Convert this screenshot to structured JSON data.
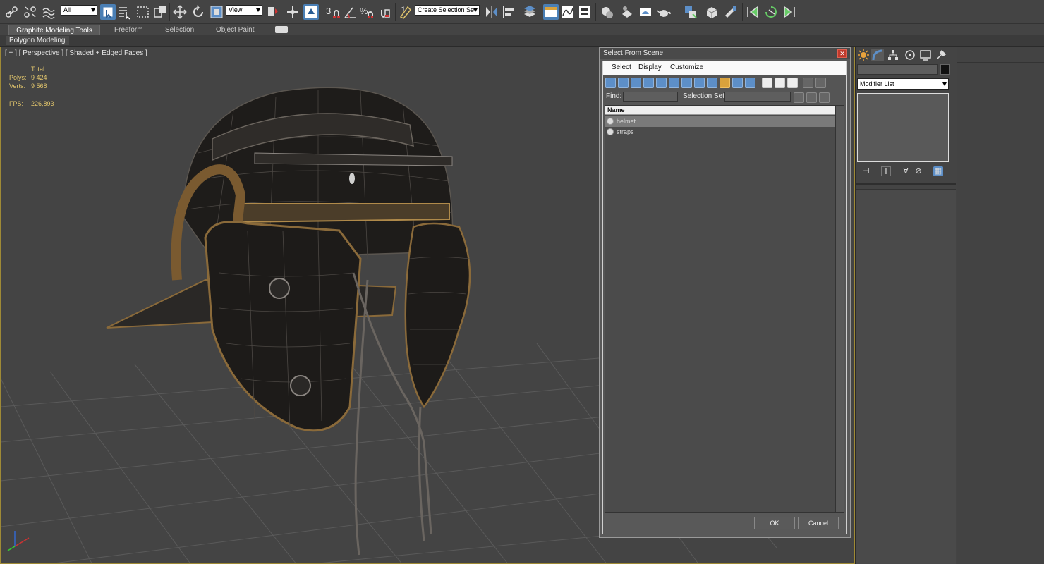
{
  "toolbar": {
    "selection_filter": "All",
    "reference_coord": "View",
    "snap_labels": [
      "3",
      "%",
      "n"
    ],
    "named_selection_placeholder": "Create Selection Se",
    "icons": [
      "link-icon",
      "unlink-icon",
      "bind-spacewarp-icon",
      "select-object-icon",
      "select-by-name-icon",
      "rect-region-icon",
      "window-crossing-icon",
      "move-icon",
      "rotate-icon",
      "scale-icon",
      "select-manipulate-icon",
      "keyboard-shortcut-icon",
      "snaps-toggle-icon",
      "angle-snap-icon",
      "percent-snap-icon",
      "spinner-snap-icon",
      "edit-named-selection-icon",
      "mirror-icon",
      "align-icon",
      "layer-manager-icon",
      "graphite-toggle-icon",
      "curve-editor-icon",
      "schematic-view-icon",
      "material-editor-icon",
      "render-setup-icon",
      "rendered-frame-icon",
      "render-icon",
      "teapot-icon"
    ]
  },
  "ribbon": {
    "tabs": [
      "Graphite Modeling Tools",
      "Freeform",
      "Selection",
      "Object Paint"
    ],
    "active_tab": "Graphite Modeling Tools",
    "sub_panel": "Polygon Modeling"
  },
  "viewport": {
    "label": "[ + ] [ Perspective ] [ Shaded + Edged Faces ]",
    "stats": {
      "total_label": "Total",
      "polys_label": "Polys:",
      "polys_value": "9 424",
      "verts_label": "Verts:",
      "verts_value": "9 568",
      "fps_label": "FPS:",
      "fps_value": "226,893"
    }
  },
  "dialog": {
    "title": "Select From Scene",
    "close_glyph": "✕",
    "menu": [
      "Select",
      "Display",
      "Customize"
    ],
    "find_label": "Find:",
    "selection_set_label": "Selection Set:",
    "list_header": "Name",
    "objects": [
      {
        "name": "helmet",
        "selected": true
      },
      {
        "name": "straps",
        "selected": false
      }
    ],
    "ok_label": "OK",
    "cancel_label": "Cancel"
  },
  "command_panel": {
    "modifier_list": "Modifier List",
    "tabs": [
      "create-icon",
      "modify-icon",
      "hierarchy-icon",
      "motion-icon",
      "display-icon",
      "utilities-icon"
    ]
  },
  "colors": {
    "accent_blue": "#4a7fb5",
    "viewport_border": "#9f8a36",
    "stats_text": "#e0c46c",
    "helmet_body": "#1e1c1a",
    "helmet_trim": "#8a6a3a"
  }
}
